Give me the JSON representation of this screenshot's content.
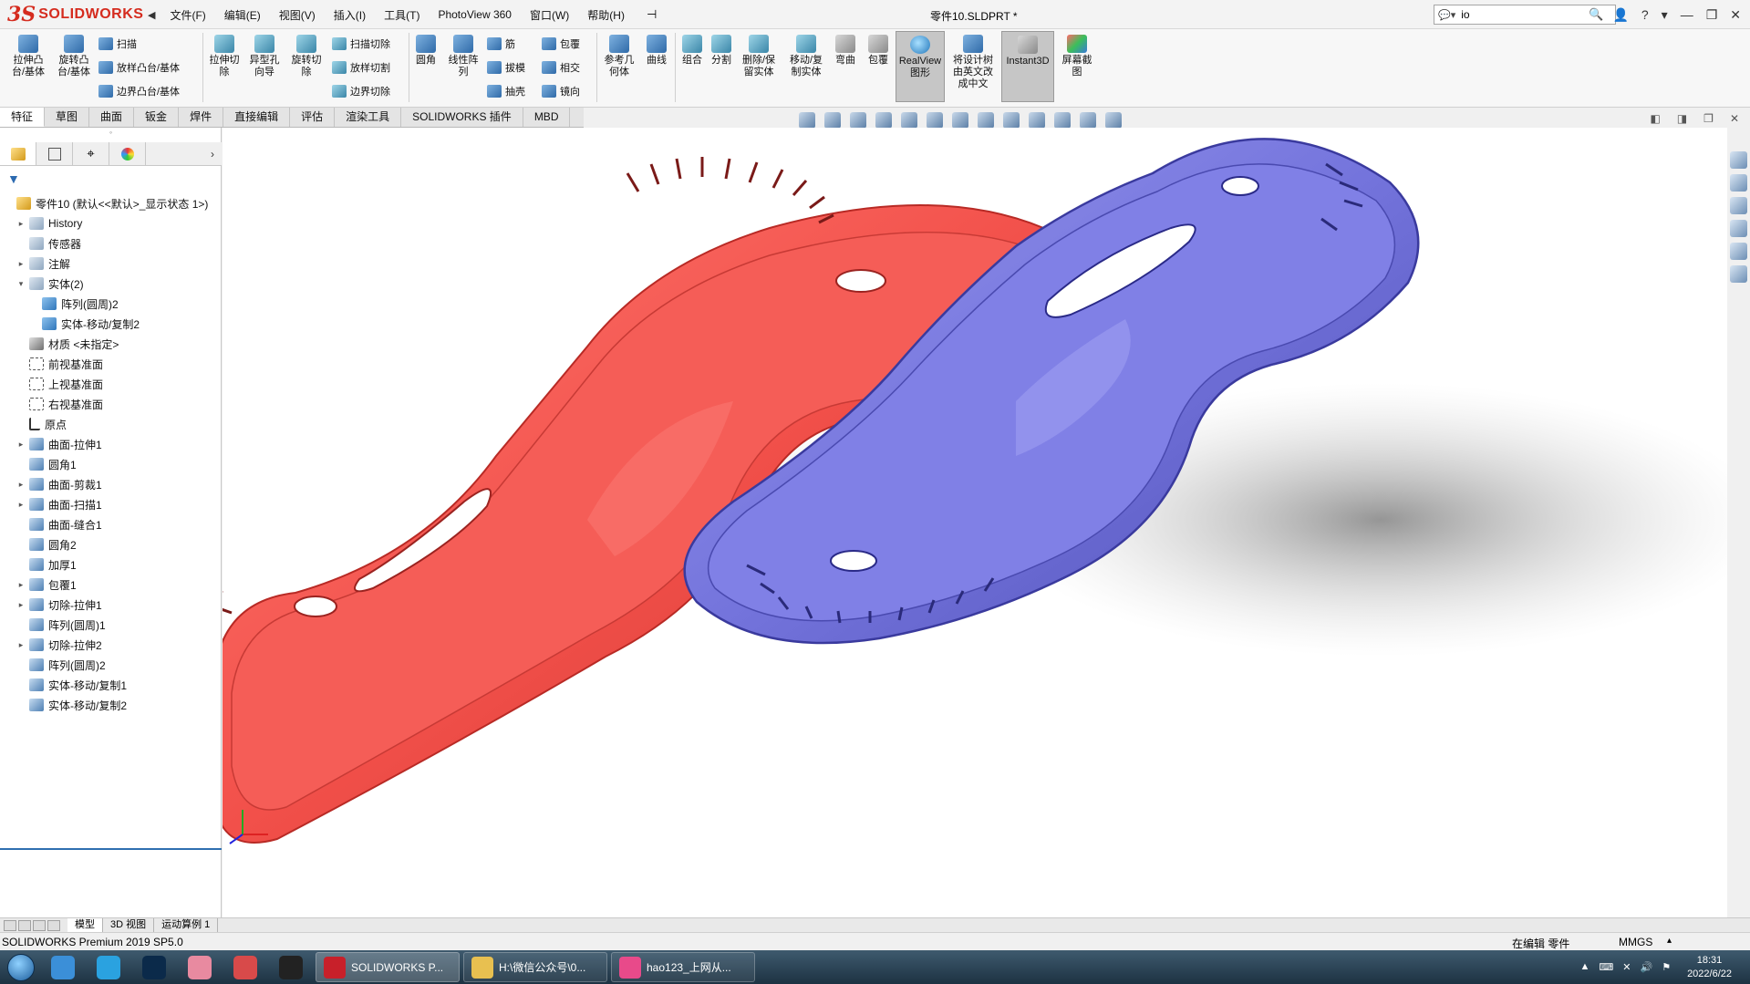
{
  "titlebar": {
    "logo_ds": "3S",
    "logo_text": "SOLIDWORKS",
    "menu_arrow": "◀",
    "menu": [
      "文件(F)",
      "编辑(E)",
      "视图(V)",
      "插入(I)",
      "工具(T)",
      "PhotoView 360",
      "窗口(W)",
      "帮助(H)"
    ],
    "pin": "⊣",
    "doc_title": "零件10.SLDPRT *",
    "search_value": "io",
    "search_icon": "🔍",
    "window_controls": [
      "👤",
      "?",
      "▾",
      "—",
      "❐",
      "✕"
    ]
  },
  "toolbar": {
    "big_left": [
      {
        "label": "拉伸凸\n台/基体",
        "icon": "extrude-boss-icon"
      },
      {
        "label": "旋转凸\n台/基体",
        "icon": "revolve-boss-icon"
      }
    ],
    "small_left": [
      "扫描",
      "放样凸台/基体",
      "边界凸台/基体"
    ],
    "big_cut": [
      {
        "label": "拉伸切\n除",
        "icon": "extrude-cut-icon"
      },
      {
        "label": "异型孔\n向导",
        "icon": "hole-wizard-icon"
      },
      {
        "label": "旋转切\n除",
        "icon": "revolve-cut-icon"
      }
    ],
    "small_cut": [
      "扫描切除",
      "放样切割",
      "边界切除"
    ],
    "fillet": "圆角",
    "pattern": "线性阵\n列",
    "small_features": [
      "筋",
      "拔模",
      "抽壳"
    ],
    "small_features2": [
      "包覆",
      "相交",
      "镜向"
    ],
    "big_right": [
      {
        "label": "参考几\n何体",
        "icon": "reference-geometry-icon"
      },
      {
        "label": "曲线",
        "icon": "curves-icon"
      },
      {
        "label": "组合",
        "icon": "combine-icon"
      },
      {
        "label": "分割",
        "icon": "split-icon"
      },
      {
        "label": "删除/保\n留实体",
        "icon": "delete-keep-body-icon"
      },
      {
        "label": "移动/复\n制实体",
        "icon": "move-copy-body-icon"
      },
      {
        "label": "弯曲",
        "icon": "flex-icon"
      },
      {
        "label": "包覆",
        "icon": "wrap-icon"
      },
      {
        "label": "RealView\n图形",
        "icon": "realview-icon"
      },
      {
        "label": "将设计树\n由英文改\n成中文",
        "icon": "translate-tree-icon"
      },
      {
        "label": "Instant3D",
        "icon": "instant3d-icon"
      },
      {
        "label": "屏幕截\n图",
        "icon": "screen-capture-icon"
      }
    ]
  },
  "tabs": [
    "特征",
    "草图",
    "曲面",
    "钣金",
    "焊件",
    "直接编辑",
    "评估",
    "渲染工具",
    "SOLIDWORKS 插件",
    "MBD"
  ],
  "viewport_controls": [
    "◧",
    "◨",
    "❐",
    "✕"
  ],
  "featuremanager": {
    "grip": "◦",
    "more": "›",
    "filter": "▼",
    "tree": [
      {
        "label": "零件10  (默认<<默认>_显示状态 1>)",
        "icon": "part",
        "exp": "",
        "indent": 0
      },
      {
        "label": "History",
        "icon": "fold",
        "exp": "▸",
        "indent": 1
      },
      {
        "label": "传感器",
        "icon": "fold",
        "exp": "",
        "indent": 1
      },
      {
        "label": "注解",
        "icon": "fold",
        "exp": "▸",
        "indent": 1
      },
      {
        "label": "实体(2)",
        "icon": "fold",
        "exp": "▾",
        "indent": 1
      },
      {
        "label": "阵列(圆周)2",
        "icon": "body",
        "exp": "",
        "indent": 2
      },
      {
        "label": "实体-移动/复制2",
        "icon": "body",
        "exp": "",
        "indent": 2
      },
      {
        "label": "材质 <未指定>",
        "icon": "mat",
        "exp": "",
        "indent": 1
      },
      {
        "label": "前视基准面",
        "icon": "plane",
        "exp": "",
        "indent": 1
      },
      {
        "label": "上视基准面",
        "icon": "plane",
        "exp": "",
        "indent": 1
      },
      {
        "label": "右视基准面",
        "icon": "plane",
        "exp": "",
        "indent": 1
      },
      {
        "label": "原点",
        "icon": "origin",
        "exp": "",
        "indent": 1
      },
      {
        "label": "曲面-拉伸1",
        "icon": "feat",
        "exp": "▸",
        "indent": 1
      },
      {
        "label": "圆角1",
        "icon": "feat",
        "exp": "",
        "indent": 1
      },
      {
        "label": "曲面-剪裁1",
        "icon": "feat",
        "exp": "▸",
        "indent": 1
      },
      {
        "label": "曲面-扫描1",
        "icon": "feat",
        "exp": "▸",
        "indent": 1
      },
      {
        "label": "曲面-缝合1",
        "icon": "feat",
        "exp": "",
        "indent": 1
      },
      {
        "label": "圆角2",
        "icon": "feat",
        "exp": "",
        "indent": 1
      },
      {
        "label": "加厚1",
        "icon": "feat",
        "exp": "",
        "indent": 1
      },
      {
        "label": "包覆1",
        "icon": "feat",
        "exp": "▸",
        "indent": 1
      },
      {
        "label": "切除-拉伸1",
        "icon": "feat",
        "exp": "▸",
        "indent": 1
      },
      {
        "label": "阵列(圆周)1",
        "icon": "feat",
        "exp": "",
        "indent": 1
      },
      {
        "label": "切除-拉伸2",
        "icon": "feat",
        "exp": "▸",
        "indent": 1
      },
      {
        "label": "阵列(圆周)2",
        "icon": "feat",
        "exp": "",
        "indent": 1
      },
      {
        "label": "实体-移动/复制1",
        "icon": "feat",
        "exp": "",
        "indent": 1
      },
      {
        "label": "实体-移动/复制2",
        "icon": "feat",
        "exp": "",
        "indent": 1
      }
    ]
  },
  "colors": {
    "red_part": "#f2504a",
    "blue_part": "#7070d8",
    "accent": "#2f6fb0"
  },
  "bottom_tabs": [
    "模型",
    "3D 视图",
    "运动算例 1"
  ],
  "status": {
    "left": "SOLIDWORKS Premium 2019 SP5.0",
    "mode": "在编辑 零件",
    "units": "MMGS",
    "units_arrow": "▴"
  },
  "taskbar": {
    "windows": [
      {
        "label": "SOLIDWORKS P...",
        "icon": "solidworks-icon",
        "color": "#c8202a"
      },
      {
        "label": "H:\\微信公众号\\0...",
        "icon": "folder-icon",
        "color": "#e8c050"
      },
      {
        "label": "hao123_上网从...",
        "icon": "browser-icon",
        "color": "#e84a8a"
      }
    ],
    "pinned": [
      {
        "icon": "app-icon-1",
        "color": "#3b8fd8"
      },
      {
        "icon": "app-icon-2",
        "color": "#2aa2e0"
      },
      {
        "icon": "photoshop-icon",
        "color": "#0b2a4a"
      },
      {
        "icon": "app-icon-4",
        "color": "#e88aa0"
      },
      {
        "icon": "app-icon-5",
        "color": "#d84a4a"
      },
      {
        "icon": "app-icon-6",
        "color": "#222222"
      }
    ],
    "tray": [
      "▲",
      "⌨",
      "✕",
      "🔊",
      "⚑"
    ],
    "time": "18:31",
    "date": "2022/6/22"
  }
}
